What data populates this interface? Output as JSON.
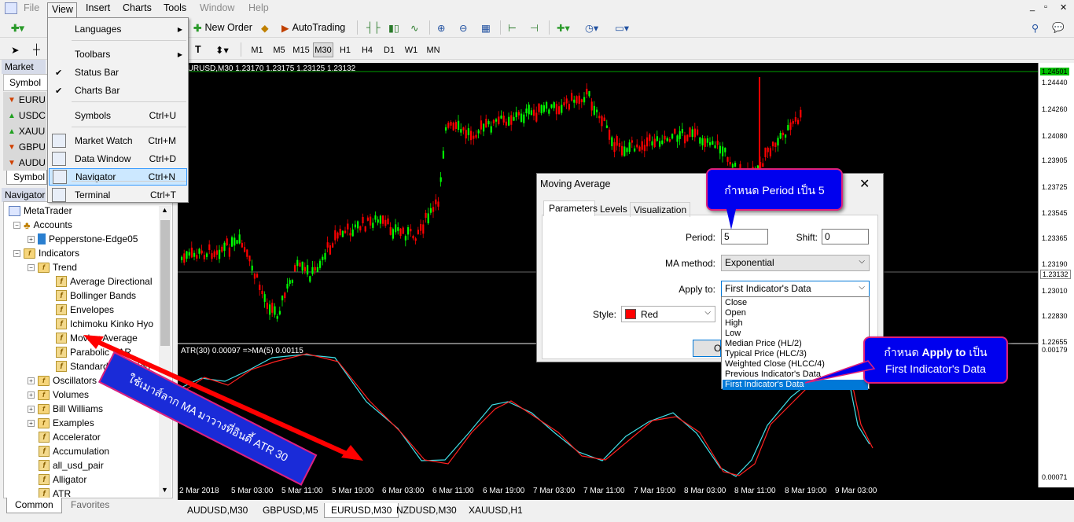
{
  "menubar": {
    "file": "File",
    "view": "View",
    "insert": "Insert",
    "charts": "Charts",
    "tools": "Tools",
    "window": "Window",
    "help": "Help"
  },
  "toolbar1": {
    "new_order": "New Order",
    "autotrading": "AutoTrading"
  },
  "timeframes": [
    "M1",
    "M5",
    "M15",
    "M30",
    "H1",
    "H4",
    "D1",
    "W1",
    "MN"
  ],
  "active_timeframe": "M30",
  "view_menu": {
    "items": [
      {
        "label": "Languages",
        "shortcut": "",
        "submenu": true
      },
      {
        "label": "Toolbars",
        "shortcut": "",
        "submenu": true
      },
      {
        "label": "Status Bar",
        "shortcut": "",
        "checked": true
      },
      {
        "label": "Charts Bar",
        "shortcut": "",
        "checked": true
      },
      {
        "label": "Symbols",
        "shortcut": "Ctrl+U"
      },
      {
        "label": "Market Watch",
        "shortcut": "Ctrl+M"
      },
      {
        "label": "Data Window",
        "shortcut": "Ctrl+D"
      },
      {
        "label": "Navigator",
        "shortcut": "Ctrl+N"
      },
      {
        "label": "Terminal",
        "shortcut": "Ctrl+T"
      }
    ]
  },
  "market_watch": {
    "title": "Market Wa",
    "header": "Symbol",
    "symbols": [
      "EURU",
      "USDC",
      "XAUU",
      "GBPU",
      "AUDU"
    ],
    "tab": "Symbol"
  },
  "navigator": {
    "title": "Navigator",
    "tree": {
      "root": "MetaTrader",
      "accounts": "Accounts",
      "account": "Pepperstone-Edge05",
      "indicators": "Indicators",
      "trend": "Trend",
      "trend_items": [
        "Average Directional",
        "Bollinger Bands",
        "Envelopes",
        "Ichimoku Kinko Hyo",
        "Moving Average",
        "Parabolic SAR",
        "Standard Deviation"
      ],
      "groups": [
        "Oscillators",
        "Volumes",
        "Bill Williams",
        "Examples"
      ],
      "custom": [
        "Accelerator",
        "Accumulation",
        "all_usd_pair",
        "Alligator",
        "ATR"
      ]
    },
    "tabs": [
      "Common",
      "Favorites"
    ]
  },
  "chart": {
    "info": "EURUSD,M30  1.23170 1.23175 1.23125 1.23132",
    "atr_info": "ATR(30) 0.00097  =>MA(5) 0.00115",
    "price_labels": [
      "1.24501",
      "1.24440",
      "1.24260",
      "1.24080",
      "1.23905",
      "1.23725",
      "1.23545",
      "1.23365",
      "1.23190",
      "1.23132",
      "1.23010",
      "1.22830",
      "1.22655"
    ],
    "atr_labels": [
      "0.00179",
      "0.00071"
    ],
    "time_labels": [
      "2 Mar 2018",
      "5 Mar 03:00",
      "5 Mar 11:00",
      "5 Mar 19:00",
      "6 Mar 03:00",
      "6 Mar 11:00",
      "6 Mar 19:00",
      "7 Mar 03:00",
      "7 Mar 11:00",
      "7 Mar 19:00",
      "8 Mar 03:00",
      "8 Mar 11:00",
      "8 Mar 19:00",
      "9 Mar 03:00"
    ]
  },
  "chart_tabs": [
    "AUDUSD,M30",
    "GBPUSD,M5",
    "EURUSD,M30",
    "NZDUSD,M30",
    "XAUUSD,H1"
  ],
  "active_chart_tab": "EURUSD,M30",
  "ma_dialog": {
    "title": "Moving Average",
    "tabs": [
      "Parameters",
      "Levels",
      "Visualization"
    ],
    "period_label": "Period:",
    "period_value": "5",
    "shift_label": "Shift:",
    "shift_value": "0",
    "method_label": "MA method:",
    "method_value": "Exponential",
    "apply_label": "Apply to:",
    "apply_value": "First Indicator's Data",
    "style_label": "Style:",
    "style_value": "Red",
    "style_color": "#ff0000",
    "ok_label": "O",
    "apply_options": [
      "Close",
      "Open",
      "High",
      "Low",
      "Median Price (HL/2)",
      "Typical Price (HLC/3)",
      "Weighted Close (HLCC/4)",
      "Previous Indicator's Data",
      "First Indicator's Data"
    ],
    "selected_option": "First Indicator's Data"
  },
  "callouts": {
    "period": "กำหนด Period เป็น 5",
    "apply_line1_pre": "กำหนด ",
    "apply_line1_bold": "Apply to",
    "apply_line1_post": " เป็น",
    "apply_line2": "First Indicator's Data",
    "drag": "ใช้เมาส์ลาก MA มาวางที่อินดี้ ATR 30"
  },
  "colors": {
    "bull": "#00ff00",
    "bear": "#ff0000",
    "atr": "#40e0e8",
    "ma": "#ff2020",
    "callout_bg": "#0000ee",
    "callout_border": "#e0207a"
  }
}
